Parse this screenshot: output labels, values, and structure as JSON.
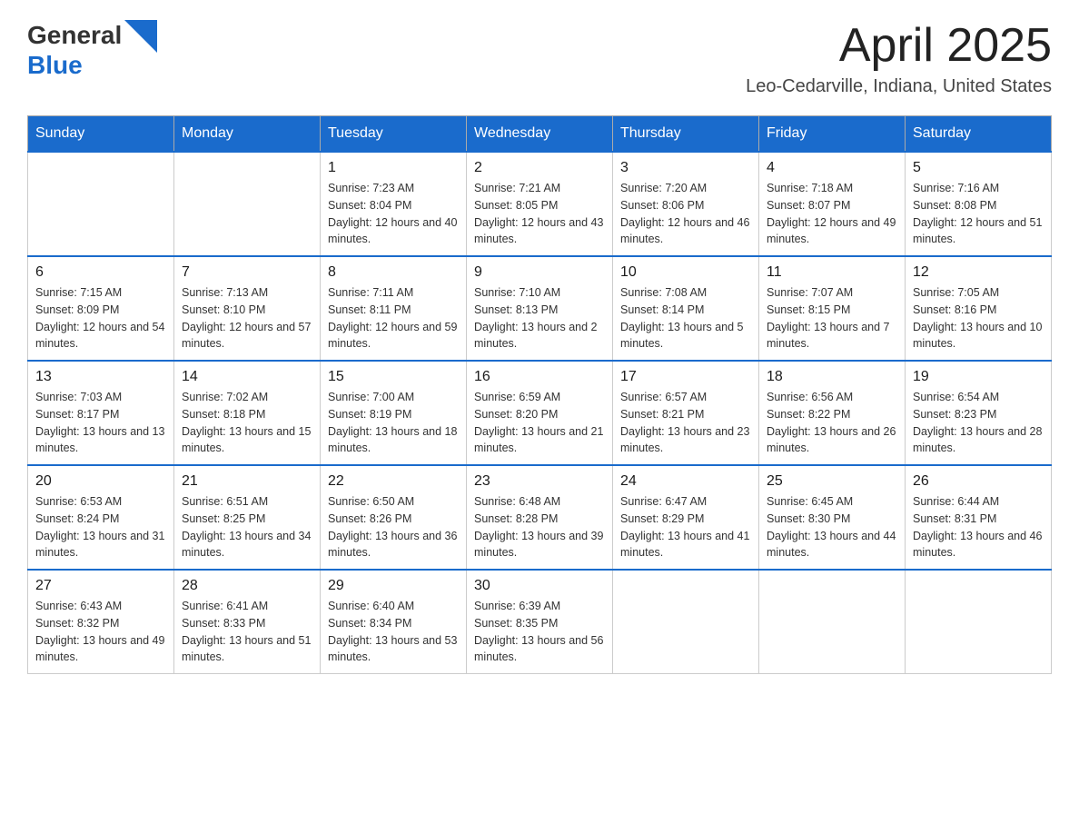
{
  "header": {
    "logo": {
      "general": "General",
      "blue": "Blue",
      "triangle_color": "#1a6bcc"
    },
    "title": "April 2025",
    "subtitle": "Leo-Cedarville, Indiana, United States"
  },
  "columns": [
    "Sunday",
    "Monday",
    "Tuesday",
    "Wednesday",
    "Thursday",
    "Friday",
    "Saturday"
  ],
  "weeks": [
    [
      {
        "day": "",
        "sunrise": "",
        "sunset": "",
        "daylight": ""
      },
      {
        "day": "",
        "sunrise": "",
        "sunset": "",
        "daylight": ""
      },
      {
        "day": "1",
        "sunrise": "Sunrise: 7:23 AM",
        "sunset": "Sunset: 8:04 PM",
        "daylight": "Daylight: 12 hours and 40 minutes."
      },
      {
        "day": "2",
        "sunrise": "Sunrise: 7:21 AM",
        "sunset": "Sunset: 8:05 PM",
        "daylight": "Daylight: 12 hours and 43 minutes."
      },
      {
        "day": "3",
        "sunrise": "Sunrise: 7:20 AM",
        "sunset": "Sunset: 8:06 PM",
        "daylight": "Daylight: 12 hours and 46 minutes."
      },
      {
        "day": "4",
        "sunrise": "Sunrise: 7:18 AM",
        "sunset": "Sunset: 8:07 PM",
        "daylight": "Daylight: 12 hours and 49 minutes."
      },
      {
        "day": "5",
        "sunrise": "Sunrise: 7:16 AM",
        "sunset": "Sunset: 8:08 PM",
        "daylight": "Daylight: 12 hours and 51 minutes."
      }
    ],
    [
      {
        "day": "6",
        "sunrise": "Sunrise: 7:15 AM",
        "sunset": "Sunset: 8:09 PM",
        "daylight": "Daylight: 12 hours and 54 minutes."
      },
      {
        "day": "7",
        "sunrise": "Sunrise: 7:13 AM",
        "sunset": "Sunset: 8:10 PM",
        "daylight": "Daylight: 12 hours and 57 minutes."
      },
      {
        "day": "8",
        "sunrise": "Sunrise: 7:11 AM",
        "sunset": "Sunset: 8:11 PM",
        "daylight": "Daylight: 12 hours and 59 minutes."
      },
      {
        "day": "9",
        "sunrise": "Sunrise: 7:10 AM",
        "sunset": "Sunset: 8:13 PM",
        "daylight": "Daylight: 13 hours and 2 minutes."
      },
      {
        "day": "10",
        "sunrise": "Sunrise: 7:08 AM",
        "sunset": "Sunset: 8:14 PM",
        "daylight": "Daylight: 13 hours and 5 minutes."
      },
      {
        "day": "11",
        "sunrise": "Sunrise: 7:07 AM",
        "sunset": "Sunset: 8:15 PM",
        "daylight": "Daylight: 13 hours and 7 minutes."
      },
      {
        "day": "12",
        "sunrise": "Sunrise: 7:05 AM",
        "sunset": "Sunset: 8:16 PM",
        "daylight": "Daylight: 13 hours and 10 minutes."
      }
    ],
    [
      {
        "day": "13",
        "sunrise": "Sunrise: 7:03 AM",
        "sunset": "Sunset: 8:17 PM",
        "daylight": "Daylight: 13 hours and 13 minutes."
      },
      {
        "day": "14",
        "sunrise": "Sunrise: 7:02 AM",
        "sunset": "Sunset: 8:18 PM",
        "daylight": "Daylight: 13 hours and 15 minutes."
      },
      {
        "day": "15",
        "sunrise": "Sunrise: 7:00 AM",
        "sunset": "Sunset: 8:19 PM",
        "daylight": "Daylight: 13 hours and 18 minutes."
      },
      {
        "day": "16",
        "sunrise": "Sunrise: 6:59 AM",
        "sunset": "Sunset: 8:20 PM",
        "daylight": "Daylight: 13 hours and 21 minutes."
      },
      {
        "day": "17",
        "sunrise": "Sunrise: 6:57 AM",
        "sunset": "Sunset: 8:21 PM",
        "daylight": "Daylight: 13 hours and 23 minutes."
      },
      {
        "day": "18",
        "sunrise": "Sunrise: 6:56 AM",
        "sunset": "Sunset: 8:22 PM",
        "daylight": "Daylight: 13 hours and 26 minutes."
      },
      {
        "day": "19",
        "sunrise": "Sunrise: 6:54 AM",
        "sunset": "Sunset: 8:23 PM",
        "daylight": "Daylight: 13 hours and 28 minutes."
      }
    ],
    [
      {
        "day": "20",
        "sunrise": "Sunrise: 6:53 AM",
        "sunset": "Sunset: 8:24 PM",
        "daylight": "Daylight: 13 hours and 31 minutes."
      },
      {
        "day": "21",
        "sunrise": "Sunrise: 6:51 AM",
        "sunset": "Sunset: 8:25 PM",
        "daylight": "Daylight: 13 hours and 34 minutes."
      },
      {
        "day": "22",
        "sunrise": "Sunrise: 6:50 AM",
        "sunset": "Sunset: 8:26 PM",
        "daylight": "Daylight: 13 hours and 36 minutes."
      },
      {
        "day": "23",
        "sunrise": "Sunrise: 6:48 AM",
        "sunset": "Sunset: 8:28 PM",
        "daylight": "Daylight: 13 hours and 39 minutes."
      },
      {
        "day": "24",
        "sunrise": "Sunrise: 6:47 AM",
        "sunset": "Sunset: 8:29 PM",
        "daylight": "Daylight: 13 hours and 41 minutes."
      },
      {
        "day": "25",
        "sunrise": "Sunrise: 6:45 AM",
        "sunset": "Sunset: 8:30 PM",
        "daylight": "Daylight: 13 hours and 44 minutes."
      },
      {
        "day": "26",
        "sunrise": "Sunrise: 6:44 AM",
        "sunset": "Sunset: 8:31 PM",
        "daylight": "Daylight: 13 hours and 46 minutes."
      }
    ],
    [
      {
        "day": "27",
        "sunrise": "Sunrise: 6:43 AM",
        "sunset": "Sunset: 8:32 PM",
        "daylight": "Daylight: 13 hours and 49 minutes."
      },
      {
        "day": "28",
        "sunrise": "Sunrise: 6:41 AM",
        "sunset": "Sunset: 8:33 PM",
        "daylight": "Daylight: 13 hours and 51 minutes."
      },
      {
        "day": "29",
        "sunrise": "Sunrise: 6:40 AM",
        "sunset": "Sunset: 8:34 PM",
        "daylight": "Daylight: 13 hours and 53 minutes."
      },
      {
        "day": "30",
        "sunrise": "Sunrise: 6:39 AM",
        "sunset": "Sunset: 8:35 PM",
        "daylight": "Daylight: 13 hours and 56 minutes."
      },
      {
        "day": "",
        "sunrise": "",
        "sunset": "",
        "daylight": ""
      },
      {
        "day": "",
        "sunrise": "",
        "sunset": "",
        "daylight": ""
      },
      {
        "day": "",
        "sunrise": "",
        "sunset": "",
        "daylight": ""
      }
    ]
  ]
}
